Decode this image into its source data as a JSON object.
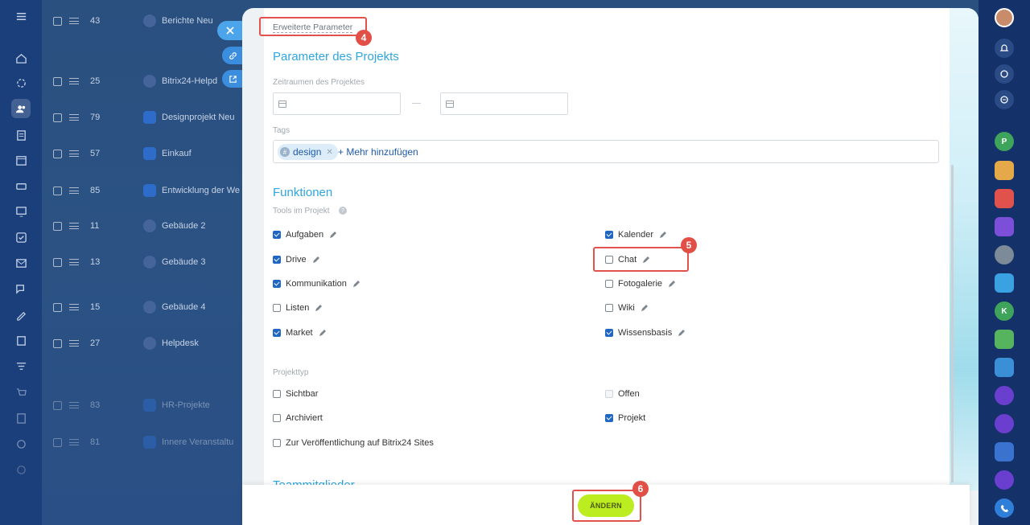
{
  "background_list": {
    "rows": [
      {
        "id": "43",
        "name": "Berichte Neu",
        "kind": "avatar"
      },
      {
        "id": "25",
        "name": "Bitrix24-Helpd",
        "kind": "avatar"
      },
      {
        "id": "79",
        "name": "Designprojekt Neu",
        "kind": "folder"
      },
      {
        "id": "57",
        "name": "Einkauf",
        "kind": "folder"
      },
      {
        "id": "85",
        "name": "Entwicklung der We",
        "kind": "folder"
      },
      {
        "id": "11",
        "name": "Gebäude 2",
        "kind": "avatar"
      },
      {
        "id": "13",
        "name": "Gebäude 3",
        "kind": "avatar"
      },
      {
        "id": "15",
        "name": "Gebäude 4",
        "kind": "avatar"
      },
      {
        "id": "27",
        "name": "Helpdesk",
        "kind": "avatar"
      },
      {
        "id": "83",
        "name": "HR-Projekte",
        "kind": "folder"
      },
      {
        "id": "81",
        "name": "Innere Veranstaltu",
        "kind": "folder"
      }
    ]
  },
  "panel": {
    "advanced_link": "Erweiterte Parameter",
    "params_title": "Parameter des Projekts",
    "timeframe_label": "Zeitraumen des Projektes",
    "tags_label": "Tags",
    "tag": "design",
    "add_more": "+ Mehr hinzufügen",
    "functions_title": "Funktionen",
    "tools_label": "Tools im Projekt",
    "tools_left": [
      {
        "label": "Aufgaben",
        "checked": true
      },
      {
        "label": "Drive",
        "checked": true
      },
      {
        "label": "Kommunikation",
        "checked": true
      },
      {
        "label": "Listen",
        "checked": false
      },
      {
        "label": "Market",
        "checked": true
      }
    ],
    "tools_right": [
      {
        "label": "Kalender",
        "checked": true
      },
      {
        "label": "Chat",
        "checked": false
      },
      {
        "label": "Fotogalerie",
        "checked": false
      },
      {
        "label": "Wiki",
        "checked": false
      },
      {
        "label": "Wissensbasis",
        "checked": true
      }
    ],
    "project_type_label": "Projekttyp",
    "type_left": [
      {
        "label": "Sichtbar",
        "checked": false
      },
      {
        "label": "Archiviert",
        "checked": false
      },
      {
        "label": "Zur Veröffentlichung auf Bitrix24 Sites",
        "checked": false
      }
    ],
    "type_right": [
      {
        "label": "Offen",
        "checked": false,
        "disabled": true
      },
      {
        "label": "Projekt",
        "checked": true
      }
    ],
    "team_title": "Teammitglieder",
    "save_label": "ÄNDERN"
  },
  "annotations": {
    "a4": "4",
    "a5": "5",
    "a6": "6"
  },
  "right_rail": {
    "p_label": "P",
    "k_label": "K"
  },
  "colors": {
    "accent": "#2fa6df",
    "checkbox": "#2067c3",
    "save": "#bbed21",
    "highlight": "#e0524b"
  }
}
